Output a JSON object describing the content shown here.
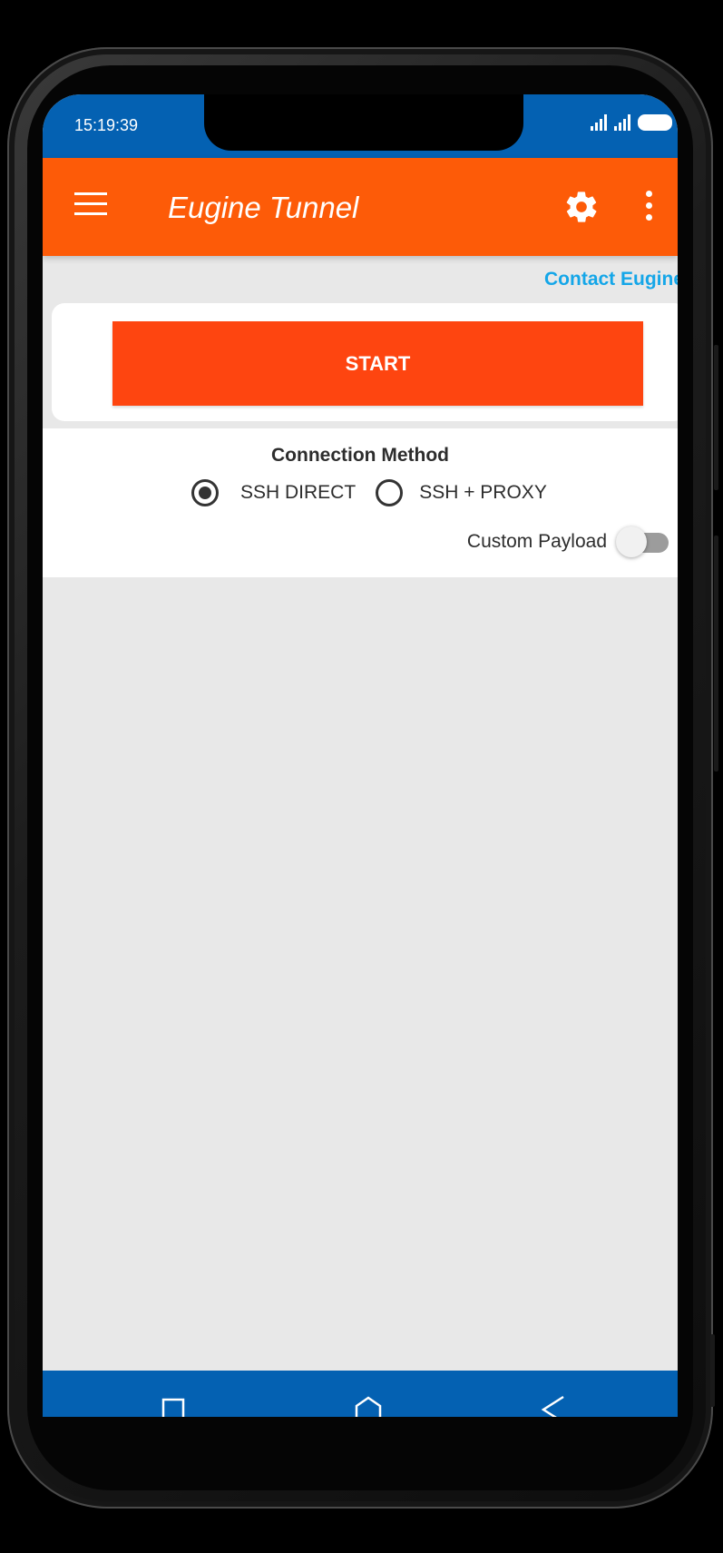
{
  "status_bar": {
    "time": "15:19:39"
  },
  "app_bar": {
    "title": "Eugine Tunnel",
    "menu_icon": "menu-icon",
    "settings_icon": "gear-icon",
    "overflow_icon": "more-vert-icon"
  },
  "contact_link": "Contact Eugine",
  "start_button": "START",
  "connection": {
    "title": "Connection Method",
    "options": [
      {
        "label": "SSH DIRECT",
        "checked": true
      },
      {
        "label": "SSH + PROXY",
        "checked": false
      }
    ],
    "payload_switch": {
      "label": "Custom Payload",
      "on": false
    }
  },
  "colors": {
    "status_bar": "#0461b2",
    "app_bar": "#fd5b08",
    "start_button": "#fe4510",
    "link": "#14a6e8"
  },
  "nav_bar": {
    "icons": [
      "recent-apps-icon",
      "home-icon",
      "back-icon"
    ]
  }
}
